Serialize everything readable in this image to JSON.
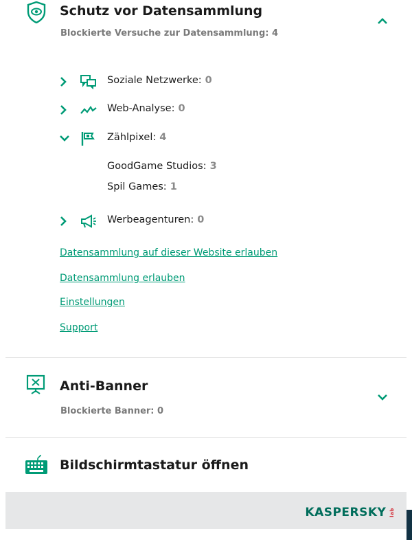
{
  "data_protection": {
    "title": "Schutz vor Datensammlung",
    "subtitle": "Blockierte Versuche zur Datensammlung: 4",
    "categories": [
      {
        "label": "Soziale Netzwerke:",
        "count": "0",
        "icon": "social-network-icon",
        "expanded": false
      },
      {
        "label": "Web-Analyse:",
        "count": "0",
        "icon": "web-analytics-icon",
        "expanded": false
      },
      {
        "label": "Zählpixel:",
        "count": "4",
        "icon": "tracking-pixel-icon",
        "expanded": true,
        "items": [
          {
            "label": "GoodGame Studios:",
            "count": "3"
          },
          {
            "label": "Spil Games:",
            "count": "1"
          }
        ]
      },
      {
        "label": "Werbeagenturen:",
        "count": "0",
        "icon": "advertising-icon",
        "expanded": false
      }
    ],
    "links": [
      "Datensammlung auf dieser Website erlauben",
      "Datensammlung erlauben",
      "Einstellungen",
      "Support"
    ]
  },
  "anti_banner": {
    "title": "Anti-Banner",
    "subtitle": "Blockierte Banner: 0"
  },
  "keyboard": {
    "title": "Bildschirmtastatur öffnen"
  },
  "footer": {
    "logo": "KASPERSKY",
    "logo_suffix": "lab"
  },
  "colors": {
    "accent": "#009b76",
    "muted": "#7a7a7a",
    "footer_bg": "#e6e7e8",
    "logo_red": "#d2222d"
  }
}
